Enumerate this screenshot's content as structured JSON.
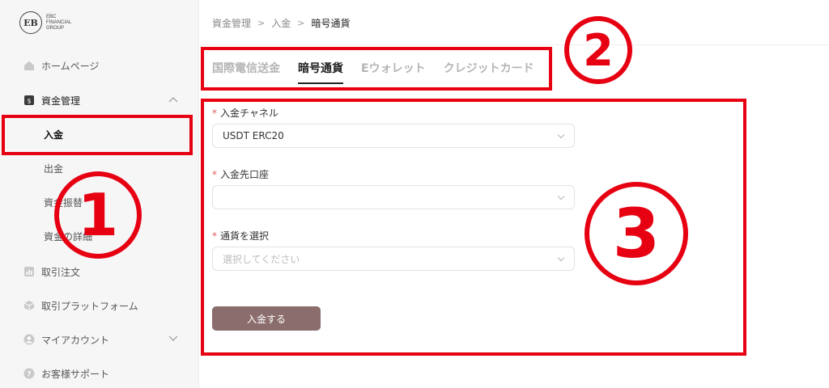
{
  "brand": {
    "mark": "EB",
    "line1": "EBC",
    "line2": "FINANCIAL",
    "line3": "GROUP"
  },
  "sidebar": {
    "items": [
      {
        "label": "ホームページ",
        "icon": "home-icon"
      },
      {
        "label": "資金管理",
        "icon": "wallet-icon"
      },
      {
        "label": "取引注文",
        "icon": "chart-icon"
      },
      {
        "label": "取引プラットフォーム",
        "icon": "box-icon"
      },
      {
        "label": "マイアカウント",
        "icon": "user-icon"
      },
      {
        "label": "お客様サポート",
        "icon": "help-icon"
      }
    ],
    "sub_items": [
      {
        "label": "入金"
      },
      {
        "label": "出金"
      },
      {
        "label": "資金振替"
      },
      {
        "label": "資金の詳細"
      }
    ]
  },
  "breadcrumb": {
    "items": [
      "資金管理",
      "入金",
      "暗号通貨"
    ]
  },
  "tabs": [
    {
      "label": "国際電信送金"
    },
    {
      "label": "暗号通貨"
    },
    {
      "label": "Eウォレット"
    },
    {
      "label": "クレジットカード"
    }
  ],
  "form": {
    "channel": {
      "label": "入金チャネル",
      "value": "USDT ERC20"
    },
    "account": {
      "label": "入金先口座",
      "value": ""
    },
    "currency": {
      "label": "通貨を選択",
      "placeholder": "選択してください"
    },
    "submit_label": "入金する"
  },
  "annotations": {
    "one": "1",
    "two": "2",
    "three": "3"
  },
  "colors": {
    "annotation": "#e60012",
    "button": "#8b6d6d"
  }
}
